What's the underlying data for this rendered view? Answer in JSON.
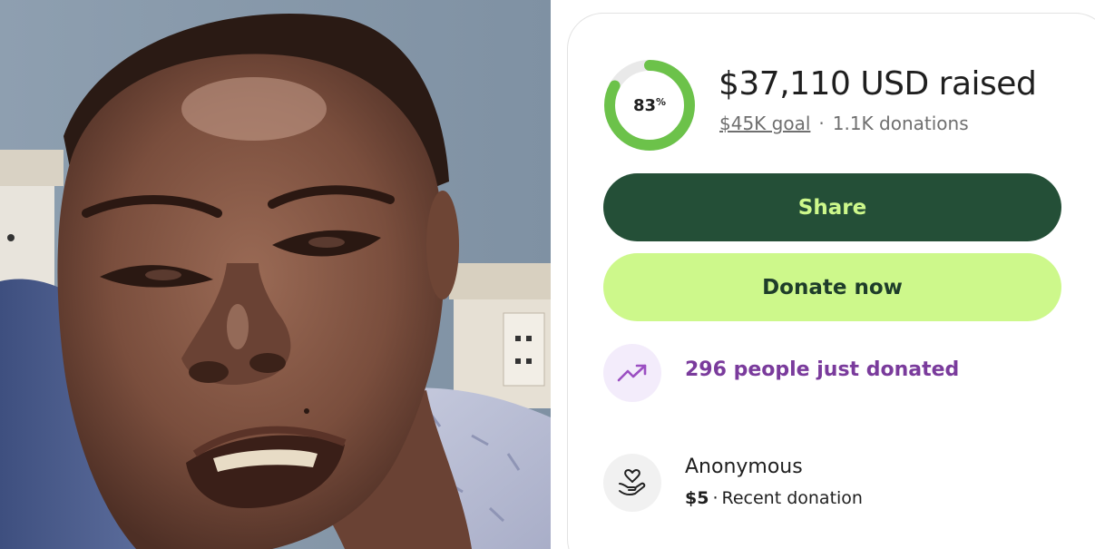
{
  "fundraiser": {
    "progress_percent_value": 83,
    "progress_percent_label": "83",
    "progress_percent_sign": "%",
    "raised_text": "$37,110 USD raised",
    "goal_text": "$45K goal",
    "separator": "·",
    "donations_text": "1.1K donations"
  },
  "actions": {
    "share_label": "Share",
    "donate_label": "Donate now"
  },
  "activity": {
    "trend_text": "296 people just donated",
    "trend_icon": "trending-up-icon"
  },
  "recent_donation": {
    "donor_name": "Anonymous",
    "amount": "$5",
    "separator": "·",
    "label": "Recent donation",
    "icon": "heart-hands-icon"
  },
  "colors": {
    "ring_progress": "#6cc24a",
    "ring_track": "#e9e9e9",
    "share_bg": "#244f37",
    "share_text": "#cdf88b",
    "donate_bg": "#cdf88b",
    "donate_text": "#1e3d2a",
    "trend_text": "#7a3b9c",
    "trend_bg": "#f3ecfb"
  }
}
